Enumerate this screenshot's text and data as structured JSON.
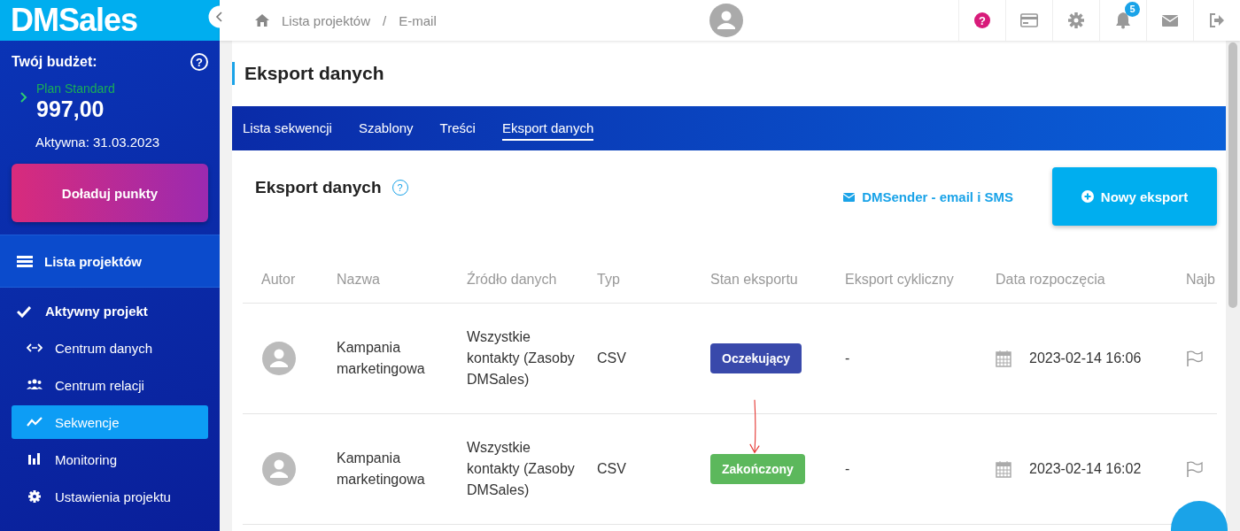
{
  "logo": {
    "text": "DMSales"
  },
  "budget": {
    "title": "Twój budżet:",
    "help": "?",
    "plan": "Plan Standard",
    "amount": "997,00",
    "active": "Aktywna: 31.03.2023",
    "button": "Doładuj punkty"
  },
  "sidebar": {
    "projects_link": "Lista projektów",
    "section": "Aktywny projekt",
    "items": [
      {
        "label": "Centrum danych",
        "selected": false
      },
      {
        "label": "Centrum relacji",
        "selected": false
      },
      {
        "label": "Sekwencje",
        "selected": true
      },
      {
        "label": "Monitoring",
        "selected": false
      },
      {
        "label": "Ustawienia projektu",
        "selected": false
      }
    ]
  },
  "breadcrumb": {
    "items": [
      "Lista projektów",
      "E-mail"
    ],
    "separator": "/"
  },
  "topbar": {
    "help": "?",
    "notifications": "5"
  },
  "page_title": "Eksport danych",
  "tabs": [
    {
      "label": "Lista sekwencji",
      "selected": false
    },
    {
      "label": "Szablony",
      "selected": false
    },
    {
      "label": "Treści",
      "selected": false
    },
    {
      "label": "Eksport danych",
      "selected": true
    }
  ],
  "section": {
    "title": "Eksport danych",
    "help": "?",
    "link": "DMSender - email i SMS",
    "button": "Nowy eksport"
  },
  "table": {
    "columns": [
      "Autor",
      "Nazwa",
      "Źródło danych",
      "Typ",
      "Stan eksportu",
      "Eksport cykliczny",
      "Data rozpoczęcia",
      "Najb"
    ],
    "rows": [
      {
        "name": "Kampania marketingowa",
        "source": "Wszystkie kontakty (Zasoby DMSales)",
        "type": "CSV",
        "status": "Oczekujący",
        "color": "#3949ab",
        "cyclic": "-",
        "date": "2023-02-14 16:06"
      },
      {
        "name": "Kampania marketingowa",
        "source": "Wszystkie kontakty (Zasoby DMSales)",
        "type": "CSV",
        "status": "Zakończony",
        "color": "#5cb85c",
        "cyclic": "-",
        "date": "2023-02-14 16:02"
      }
    ]
  }
}
